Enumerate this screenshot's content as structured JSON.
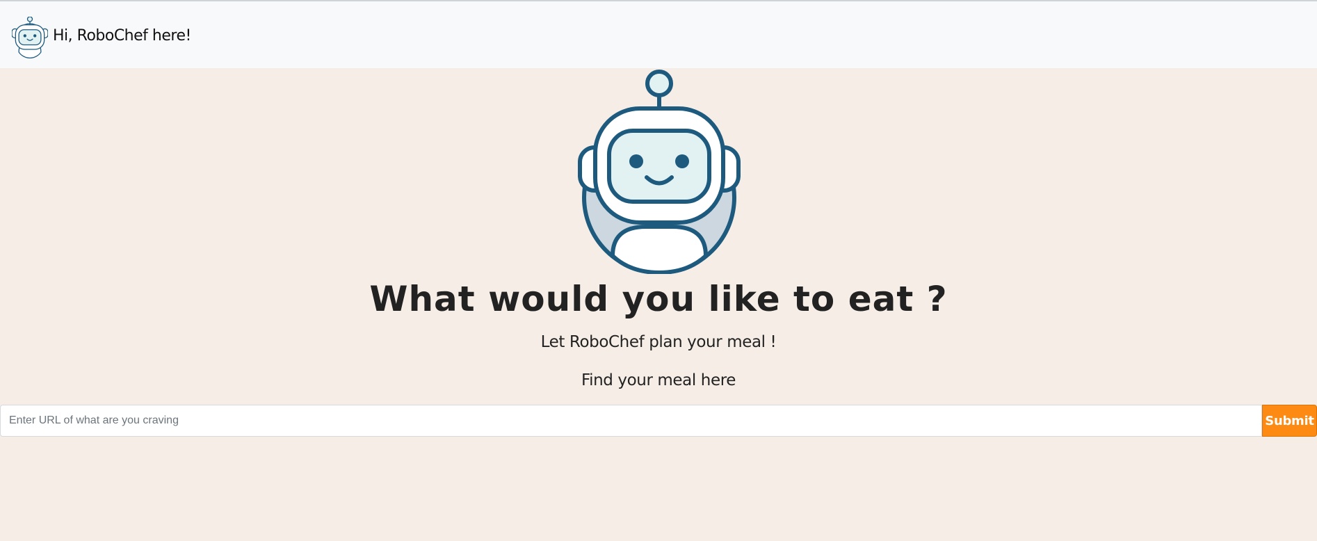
{
  "navbar": {
    "title": "Hi, RoboChef here!",
    "logo_icon": "robot-icon"
  },
  "hero": {
    "robot_icon": "robot-icon",
    "headline": "What would you like to eat ?",
    "subtitle": "Let RoboChef plan your meal !",
    "find_label": "Find your meal here"
  },
  "search": {
    "placeholder": "Enter URL of what are you craving",
    "value": "",
    "submit_label": "Submit"
  },
  "colors": {
    "page_background": "#f6eee6",
    "navbar_background": "#f8f9fb",
    "robot_stroke": "#1d5a7e",
    "robot_face": "#e2f2f3",
    "robot_body": "#ccd7df",
    "submit_button": "#fd8a12"
  }
}
